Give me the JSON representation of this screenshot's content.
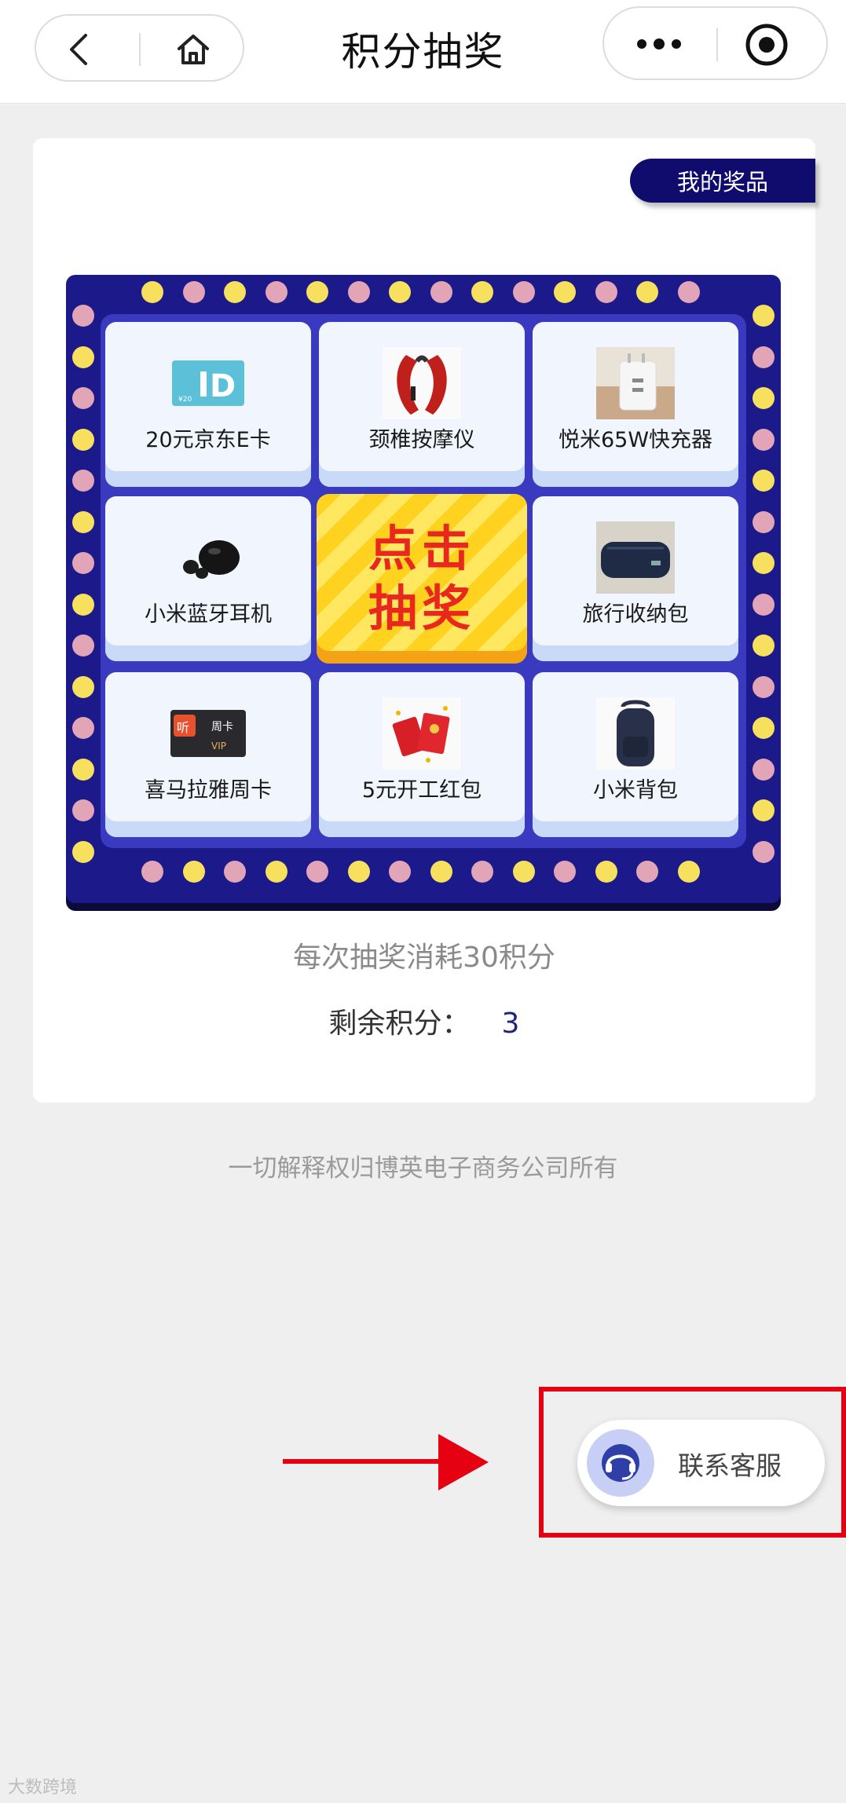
{
  "header": {
    "title": "积分抽奖",
    "back_icon": "chevron-left-icon",
    "home_icon": "home-icon",
    "more_icon": "more-dots-icon",
    "close_icon": "target-circle-icon"
  },
  "card": {
    "my_prizes_label": "我的奖品",
    "prizes": [
      {
        "label": "20元京东E卡",
        "icon": "jd-card-icon"
      },
      {
        "label": "颈椎按摩仪",
        "icon": "neck-massager-icon"
      },
      {
        "label": "悦米65W快充器",
        "icon": "charger-icon"
      },
      {
        "label": "小米蓝牙耳机",
        "icon": "earbuds-icon"
      },
      {
        "label": "旅行收纳包",
        "icon": "travel-bag-icon"
      },
      {
        "label": "喜马拉雅周卡",
        "icon": "ximalaya-card-icon"
      },
      {
        "label": "5元开工红包",
        "icon": "red-envelope-icon"
      },
      {
        "label": "小米背包",
        "icon": "backpack-icon"
      }
    ],
    "draw_button": {
      "line1": "点击",
      "line2": "抽奖"
    },
    "cost_text": "每次抽奖消耗30积分",
    "points_label": "剩余积分：",
    "points_value": "3"
  },
  "footer_note": "一切解释权归博英电子商务公司所有",
  "support": {
    "label": "联系客服",
    "icon": "headset-icon"
  },
  "watermark": "大数跨境",
  "colors": {
    "board": "#1c1a8a",
    "board_inner": "#3a3ac0",
    "dot_yellow": "#f7e05e",
    "dot_pink": "#e2a4b7",
    "draw_text": "#e8271f",
    "highlight": "#e50012",
    "my_prizes_bg": "#0f0c6e"
  }
}
